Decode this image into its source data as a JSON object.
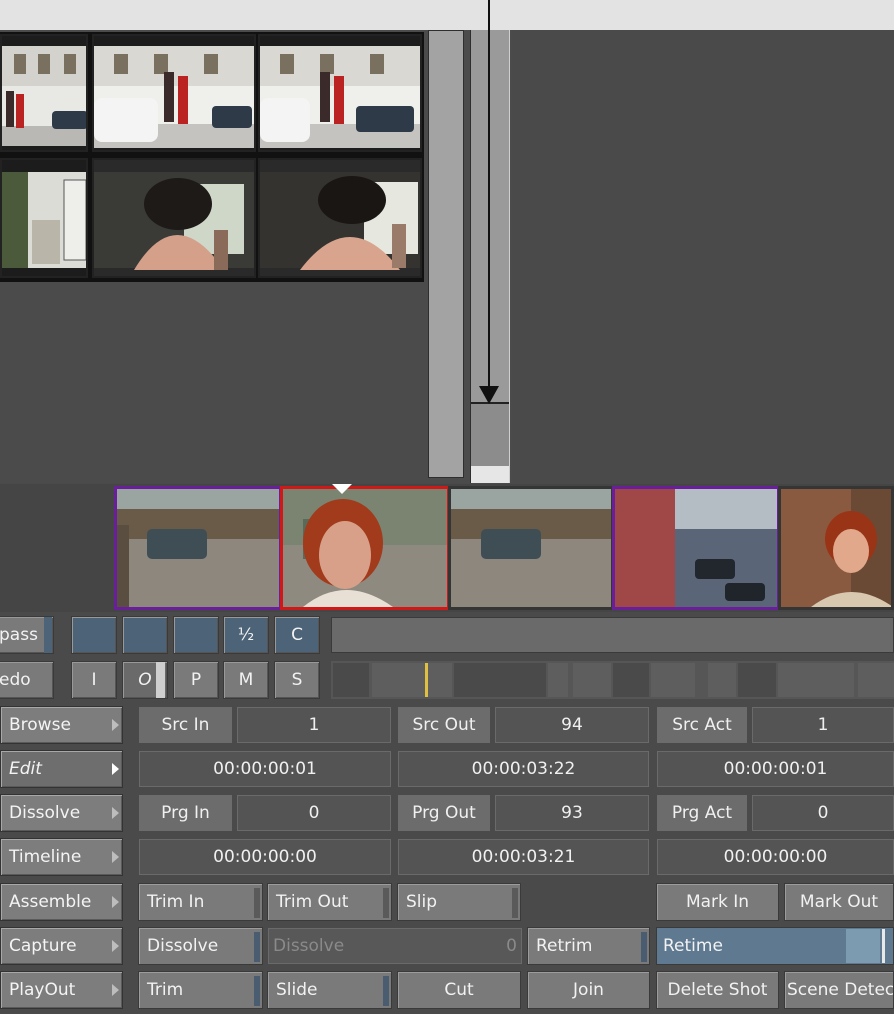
{
  "menu": {
    "items": [
      {
        "label": "Browse"
      },
      {
        "label": "Edit"
      },
      {
        "label": "Dissolve"
      },
      {
        "label": "Timeline"
      },
      {
        "label": "Assemble"
      },
      {
        "label": "Capture"
      },
      {
        "label": "PlayOut"
      }
    ]
  },
  "transport": {
    "row1_left": "pass",
    "row2_left": "edo",
    "half": "½",
    "c": "C",
    "i": "I",
    "o": "O",
    "p": "P",
    "m": "M",
    "s": "S"
  },
  "edit": {
    "src_in_label": "Src In",
    "src_in_value": "1",
    "src_in_tc": "00:00:00:01",
    "src_out_label": "Src Out",
    "src_out_value": "94",
    "src_out_tc": "00:00:03:22",
    "src_act_label": "Src Act",
    "src_act_value": "1",
    "src_act_tc": "00:00:00:01",
    "prg_in_label": "Prg In",
    "prg_in_value": "0",
    "prg_in_tc": "00:00:00:00",
    "prg_out_label": "Prg Out",
    "prg_out_value": "93",
    "prg_out_tc": "00:00:03:21",
    "prg_act_label": "Prg Act",
    "prg_act_value": "0",
    "prg_act_tc": "00:00:00:00"
  },
  "tools": {
    "trim_in": "Trim In",
    "trim_out": "Trim Out",
    "slip": "Slip",
    "mark_in": "Mark In",
    "mark_out": "Mark Out",
    "dissolve": "Dissolve",
    "dissolve_field": "Dissolve",
    "dissolve_value": "0",
    "retrim": "Retrim",
    "retime": "Retime",
    "trim": "Trim",
    "slide": "Slide",
    "cut": "Cut",
    "join": "Join",
    "delete_shot": "Delete Shot",
    "scene_detect": "Scene Detect"
  },
  "colors": {
    "accent_blue": "#4c6378",
    "selected_clip": "#d01818",
    "marked_clip": "#6a1f9a",
    "playhead": "#e0c040"
  }
}
